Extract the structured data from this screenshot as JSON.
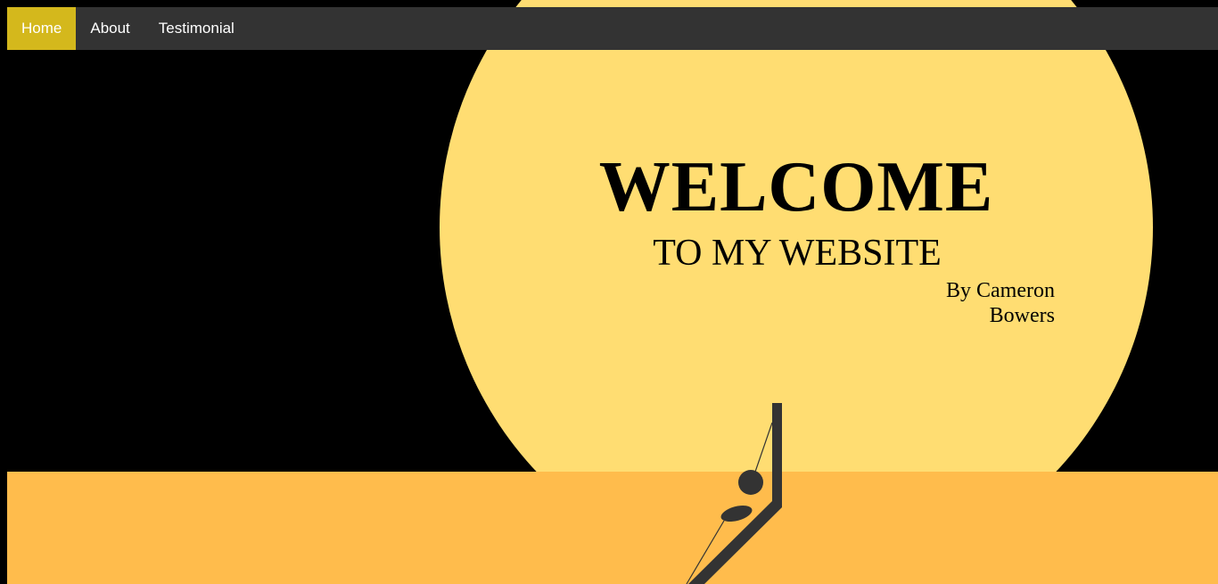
{
  "nav": {
    "items": [
      {
        "label": "Home",
        "active": true
      },
      {
        "label": "About",
        "active": false
      },
      {
        "label": "Testimonial",
        "active": false
      }
    ]
  },
  "hero": {
    "title": "WELCOME",
    "subtitle": "TO MY WEBSITE",
    "author_line1": "By Cameron",
    "author_line2": "Bowers"
  },
  "colors": {
    "background": "#000000",
    "navbar": "#333333",
    "nav_active": "#D4B81C",
    "sun": "#FFDD72",
    "ground": "#FFBC4C",
    "figure": "#333333"
  }
}
